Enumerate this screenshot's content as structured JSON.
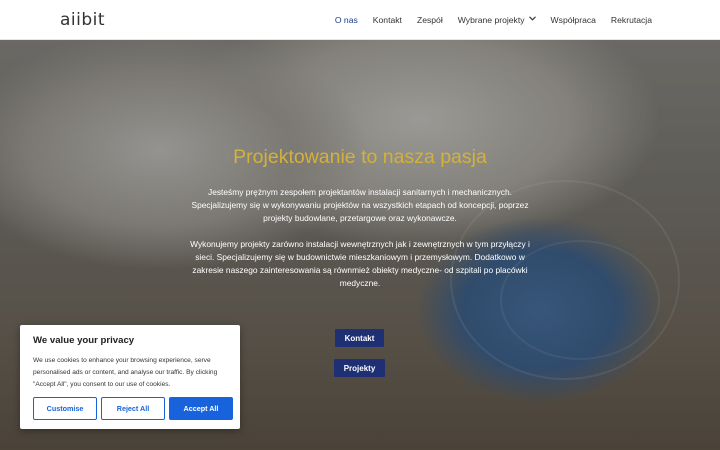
{
  "header": {
    "logo": "aiibit",
    "nav": [
      {
        "label": "O nas"
      },
      {
        "label": "Kontakt"
      },
      {
        "label": "Zespół"
      },
      {
        "label": "Wybrane projekty"
      },
      {
        "label": "Współpraca"
      },
      {
        "label": "Rekrutacja"
      }
    ],
    "dropdown_icon": "chevron-down-icon",
    "active_color": "#1e3a8a"
  },
  "hero": {
    "title": "Projektowanie to nasza pasja",
    "title_color": "#d4b13a",
    "paragraph1": "Jesteśmy prężnym zespołem projektantów instalacji sanitarnych i mechanicznych. Specjalizujemy się w wykonywaniu projektów na wszystkich etapach od koncepcji, poprzez projekty budowlane, przetargowe oraz wykonawcze.",
    "paragraph2": "Wykonujemy projekty zarówno instalacji wewnętrznych jak i zewnętrznych w tym przyłączy i sieci. Specjalizujemy się w budownictwie mieszkaniowym i przemysłowym. Dodatkowo w zakresie naszego zainteresowania są równmież obiekty medyczne- od szpitali po placówki medyczne.",
    "button_kontakt": "Kontakt",
    "button_projekty": "Projekty",
    "button_color": "#1f2f73"
  },
  "cookie": {
    "title": "We value your privacy",
    "text": "We use cookies to enhance your browsing experience, serve personalised ads or content, and analyse our traffic. By clicking \"Accept All\", you consent to our use of cookies.",
    "customise": "Customise",
    "reject": "Reject All",
    "accept": "Accept All",
    "accent_color": "#1863dc"
  }
}
